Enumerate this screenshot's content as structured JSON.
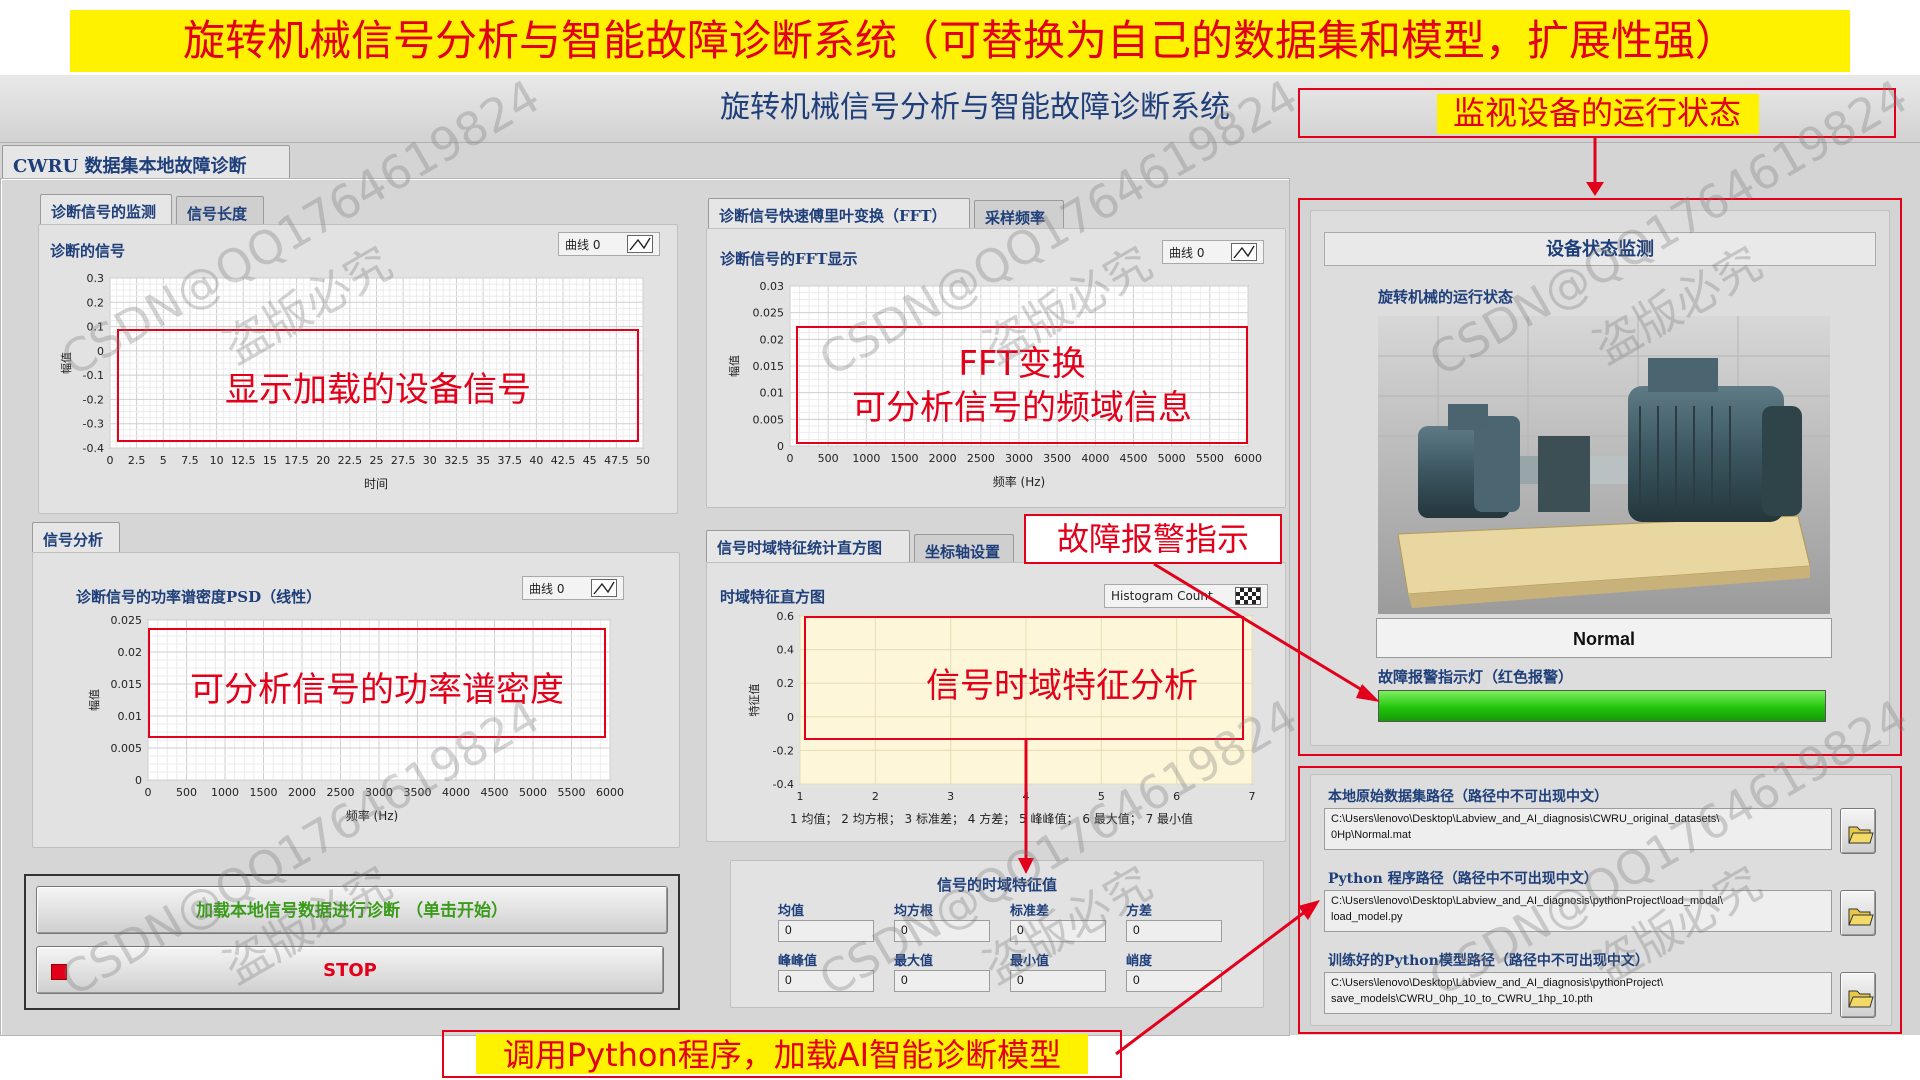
{
  "banner": "旋转机械信号分析与智能故障诊断系统（可替换为自己的数据集和模型，扩展性强）",
  "app_title": "旋转机械信号分析与智能故障诊断系统",
  "main_tab": "CWRU 数据集本地故障诊断",
  "signal_panel": {
    "tabs": [
      "诊断信号的监测",
      "信号长度"
    ],
    "chart_label": "诊断的信号",
    "legend": "曲线 0",
    "callout": "显示加载的设备信号"
  },
  "fft_panel": {
    "tabs": [
      "诊断信号快速傅里叶变换（FFT）",
      "采样频率"
    ],
    "chart_label": "诊断信号的FFT显示",
    "legend": "曲线 0",
    "callout_line1": "FFT变换",
    "callout_line2": "可分析信号的频域信息"
  },
  "psd_panel": {
    "tabs": [
      "信号分析"
    ],
    "chart_label": "诊断信号的功率谱密度PSD（线性）",
    "legend": "曲线 0",
    "callout": "可分析信号的功率谱密度"
  },
  "hist_panel": {
    "tabs": [
      "信号时域特征统计直方图",
      "坐标轴设置"
    ],
    "chart_label": "时域特征直方图",
    "legend": "Histogram Count",
    "callout": "信号时域特征分析",
    "xcaption": "1 均值；  2 均方根；  3 标准差；  4 方差；  5 峰峰值；  6 最大值；  7 最小值"
  },
  "features": {
    "title": "信号的时域特征值",
    "items": [
      {
        "label": "均值",
        "value": "0"
      },
      {
        "label": "均方根",
        "value": "0"
      },
      {
        "label": "标准差",
        "value": "0"
      },
      {
        "label": "方差",
        "value": "0"
      },
      {
        "label": "峰峰值",
        "value": "0"
      },
      {
        "label": "最大值",
        "value": "0"
      },
      {
        "label": "最小值",
        "value": "0"
      },
      {
        "label": "峭度",
        "value": "0"
      }
    ]
  },
  "buttons": {
    "load": "加载本地信号数据进行诊断 （单击开始）",
    "stop": "STOP"
  },
  "status": {
    "header": "设备状态监测",
    "machine_label": "旋转机械的运行状态",
    "state": "Normal",
    "alarm_label": "故障报警指示灯（红色报警）",
    "alarm_color": "#22c40d"
  },
  "paths": [
    {
      "label": "本地原始数据集路径（路径中不可出现中文）",
      "line1": "C:\\Users\\lenovo\\Desktop\\Labview_and_AI_diagnosis\\CWRU_original_datasets\\",
      "line2": "0Hp\\Normal.mat"
    },
    {
      "label": "Python 程序路径（路径中不可出现中文）",
      "line1": "C:\\Users\\lenovo\\Desktop\\Labview_and_AI_diagnosis\\pythonProject\\load_modal\\",
      "line2": "load_model.py"
    },
    {
      "label": "训练好的Python模型路径（路径中不可出现中文）",
      "line1": "C:\\Users\\lenovo\\Desktop\\Labview_and_AI_diagnosis\\pythonProject\\",
      "line2": "save_models\\CWRU_0hp_10_to_CWRU_1hp_10.pth"
    }
  ],
  "annotations": {
    "monitor": "监视设备的运行状态",
    "alarm": "故障报警指示",
    "python": "调用Python程序，加载AI智能诊断模型"
  },
  "watermark": {
    "line1": "CSDN@QQ1764619824",
    "line2": "盗版必究"
  },
  "colors": {
    "annotation_red": "#e3001b",
    "highlight_yellow": "#fff200",
    "label_blue": "#1f3f7a"
  },
  "chart_data": [
    {
      "type": "line",
      "title": "诊断的信号",
      "xlabel": "时间",
      "ylabel": "幅值",
      "xlim": [
        0,
        50
      ],
      "ylim": [
        -0.4,
        0.3
      ],
      "xticks": [
        "0",
        "2.5",
        "5",
        "7.5",
        "10",
        "12.5",
        "15",
        "17.5",
        "20",
        "22.5",
        "25",
        "27.5",
        "30",
        "32.5",
        "35",
        "37.5",
        "40",
        "42.5",
        "45",
        "47.5",
        "50"
      ],
      "yticks": [
        "0.3",
        "0.2",
        "0.1",
        "0",
        "-0.1",
        "-0.2",
        "-0.3",
        "-0.4"
      ],
      "series": []
    },
    {
      "type": "line",
      "title": "诊断信号的FFT显示",
      "xlabel": "频率 (Hz)",
      "ylabel": "幅值",
      "xlim": [
        0,
        6000
      ],
      "ylim": [
        0,
        0.03
      ],
      "xticks": [
        "0",
        "500",
        "1000",
        "1500",
        "2000",
        "2500",
        "3000",
        "3500",
        "4000",
        "4500",
        "5000",
        "5500",
        "6000"
      ],
      "yticks": [
        "0.03",
        "0.025",
        "0.02",
        "0.015",
        "0.01",
        "0.005",
        "0"
      ],
      "series": []
    },
    {
      "type": "line",
      "title": "诊断信号的功率谱密度PSD（线性）",
      "xlabel": "频率 (Hz)",
      "ylabel": "幅值",
      "xlim": [
        0,
        6000
      ],
      "ylim": [
        0,
        0.025
      ],
      "xticks": [
        "0",
        "500",
        "1000",
        "1500",
        "2000",
        "2500",
        "3000",
        "3500",
        "4000",
        "4500",
        "5000",
        "5500",
        "6000"
      ],
      "yticks": [
        "0.025",
        "0.02",
        "0.015",
        "0.01",
        "0.005",
        "0"
      ],
      "series": []
    },
    {
      "type": "bar",
      "title": "时域特征直方图",
      "xlabel": "",
      "ylabel": "特征值",
      "xlim": [
        1,
        7
      ],
      "ylim": [
        -0.4,
        0.6
      ],
      "xticks": [
        "1",
        "2",
        "3",
        "4",
        "5",
        "6",
        "7"
      ],
      "yticks": [
        "0.6",
        "0.4",
        "0.2",
        "0",
        "-0.2",
        "-0.4"
      ],
      "series": []
    }
  ]
}
